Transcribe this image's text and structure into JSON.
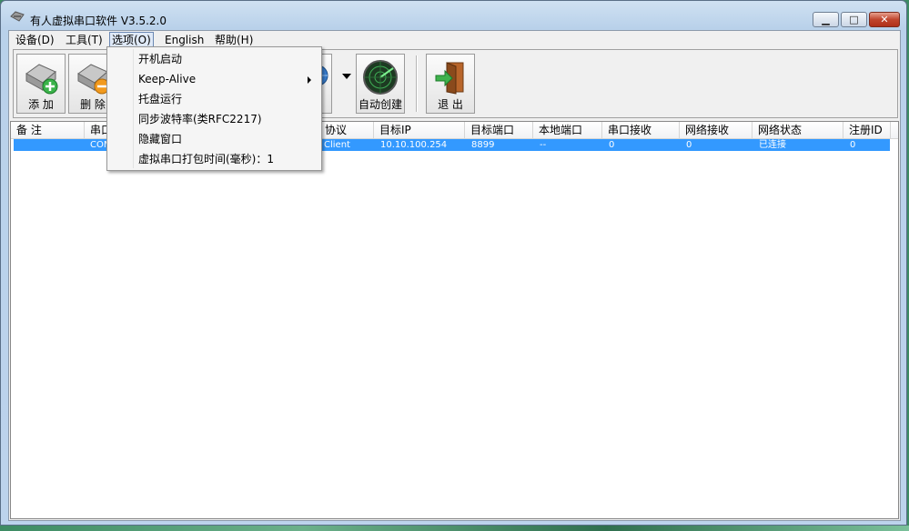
{
  "window": {
    "title": "有人虚拟串口软件 V3.5.2.0",
    "controls": {
      "minimize": "▁",
      "maximize": "□",
      "close": "✕"
    }
  },
  "menubar": [
    "设备(D)",
    "工具(T)",
    "选项(O)",
    "English",
    "帮助(H)"
  ],
  "toolbar": {
    "add_label": "添 加",
    "delete_label": "删 除",
    "auto_create_label": "自动创建",
    "exit_label": "退 出"
  },
  "options_menu": {
    "items": [
      "开机启动",
      "Keep-Alive",
      "托盘运行",
      "同步波特率(类RFC2217)",
      "隐藏窗口",
      "虚拟串口打包时间(毫秒)：1"
    ]
  },
  "table": {
    "columns": [
      "备 注",
      "串口",
      "协议",
      "目标IP",
      "目标端口",
      "本地端口",
      "串口接收",
      "网络接收",
      "网络状态",
      "注册ID"
    ],
    "rows": [
      {
        "port": "COM",
        "protocol": "Client",
        "target_ip": "10.10.100.254",
        "target_port": "8899",
        "local_port": "--",
        "serial_rx": "0",
        "net_rx": "0",
        "net_status": "已连接",
        "reg_id": "0"
      }
    ]
  },
  "colors": {
    "selection": "#3399ff",
    "window_frame": "#b9d1ea",
    "close_button": "#c0452d"
  }
}
